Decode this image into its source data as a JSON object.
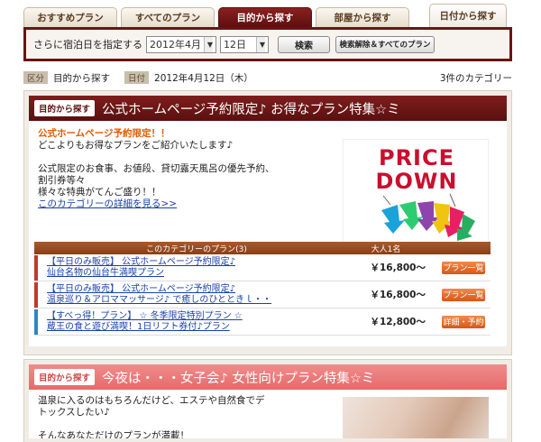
{
  "tabs": [
    {
      "label": "おすすめプラン"
    },
    {
      "label": "すべてのプラン"
    },
    {
      "label": "目的から探す"
    },
    {
      "label": "部屋から探す"
    },
    {
      "label": "日付から探す"
    }
  ],
  "search": {
    "label": "さらに宿泊日を指定する",
    "month_value": "2012年4月",
    "day_value": "12日",
    "search_button": "検索",
    "reset_button": "検索解除＆すべてのプラン"
  },
  "info": {
    "tag1": "区分",
    "value1": "目的から探す",
    "tag2": "日付",
    "value2": "2012年4月12日（木）",
    "count": "3件のカテゴリー"
  },
  "category1": {
    "badge": "目的から探す",
    "title": "公式ホームページ予約限定♪ お得なプラン特集☆ミ",
    "lead_red": "公式ホームページ予約限定！！",
    "lead": "どこよりもお得なプランをご紹介いたします♪",
    "line1": "公式限定のお食事、お値段、貸切露天風呂の優先予約、",
    "line2": "割引券等々",
    "line3": "様々な特典がてんご盛り！！",
    "detail_link": "このカテゴリーの詳細を見る>>",
    "image_text1": "PRICE",
    "image_text2": "DOWN",
    "table_header": "このカテゴリーのプラン(3)",
    "table_header_price": "大人1名",
    "plans": [
      {
        "line1": "【平日のみ販売】 公式ホームページ予約限定♪",
        "line2": "仙台名物の仙台牛満喫プラン",
        "price": "￥16,800～",
        "button": "プラン一覧",
        "bar_color": "#c0392b"
      },
      {
        "line1": "【平日のみ販売】 公式ホームページ予約限定♪",
        "line2": "温泉巡り＆アロママッサージ♪ で癒しのひとときｌ・・",
        "price": "￥16,800～",
        "button": "プラン一覧",
        "bar_color": "#c0392b"
      },
      {
        "line1": "【すべっ得！プラン】 ☆ 冬季限定特別プラン ☆",
        "line2": "蔵王の食と遊び満喫！1日リフト券付♪プラン",
        "price": "￥12,800～",
        "button": "詳細・予約",
        "bar_color": "#2e86c1"
      }
    ]
  },
  "category2": {
    "badge": "目的から探す",
    "title": "今夜は・・・女子会♪ 女性向けプラン特集☆ミ",
    "line1": "温泉に入るのはもちろんだけど、エステや自然食でデ",
    "line2": "トックスしたい♪",
    "line3": "そんなあなただけのプランが満載！"
  }
}
